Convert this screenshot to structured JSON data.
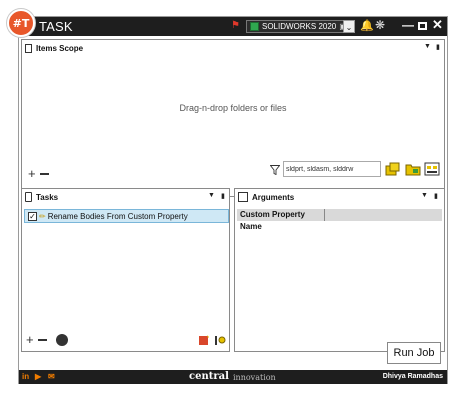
{
  "app": {
    "title": "TASK",
    "logo_text": "#T"
  },
  "titlebar": {
    "solidworks_version": "SOLIDWORKS 2020",
    "version_ext_icon": "external-link-icon",
    "controls": [
      "minimize",
      "maximize",
      "close"
    ]
  },
  "items_scope": {
    "title": "Items Scope",
    "dropzone_text": "Drag-n-drop folders or files",
    "filter_value": "sldprt, sldasm, slddrw"
  },
  "tasks": {
    "title": "Tasks",
    "items": [
      {
        "label": "Rename Bodies From Custom Property",
        "checked": true
      }
    ]
  },
  "arguments": {
    "title": "Arguments",
    "columns": [
      "Custom Property Name"
    ]
  },
  "actions": {
    "run_job": "Run Job"
  },
  "footer": {
    "brand": "central",
    "brand_sub": "innovation",
    "author": "Dhivya Ramadhas"
  },
  "colors": {
    "titlebar_bg": "#1e1e1e",
    "accent": "#e8572a",
    "selection_bg": "#cfe8f5"
  }
}
